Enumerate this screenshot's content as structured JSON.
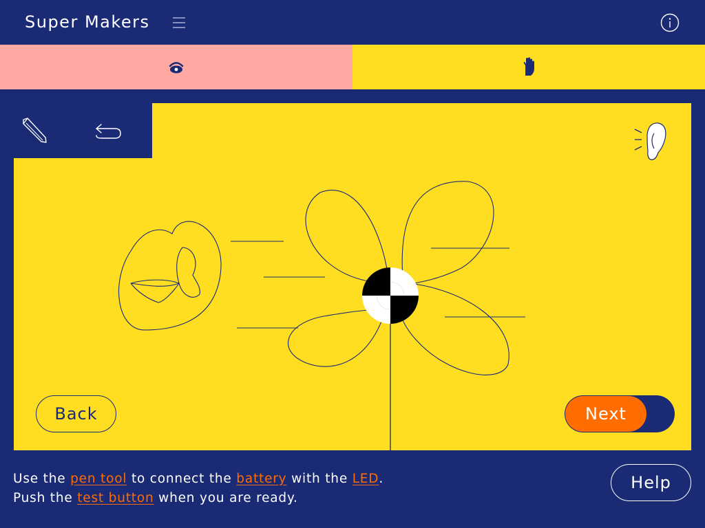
{
  "header": {
    "title": "Super Makers",
    "menu_icon": "hamburger-menu-icon",
    "info_icon": "info-icon"
  },
  "tabs": [
    {
      "id": "see",
      "icon": "eye-icon",
      "color": "#ffa9a2"
    },
    {
      "id": "touch",
      "icon": "hand-icon",
      "color": "#ffdd21"
    }
  ],
  "toolbox": {
    "tools": [
      {
        "id": "pen",
        "icon": "pencil-icon"
      },
      {
        "id": "undo",
        "icon": "undo-icon"
      }
    ]
  },
  "canvas": {
    "background": "#ffdd21",
    "sound_icon": "ear-sound-icon",
    "back_label": "Back",
    "next_label": "Next"
  },
  "instructions": {
    "line1": {
      "p1": "Use the",
      "k1": "pen tool",
      "p2": "to connect the",
      "k2": "battery",
      "p3": "with the",
      "k3": "LED",
      "p4": "."
    },
    "line2": {
      "p1": "Push the",
      "k1": "test button",
      "p2": "when you are ready."
    }
  },
  "help_label": "Help",
  "colors": {
    "navy": "#1b2a74",
    "yellow": "#ffdd21",
    "pink": "#ffa9a2",
    "orange": "#ff6d00",
    "white": "#ffffff"
  }
}
